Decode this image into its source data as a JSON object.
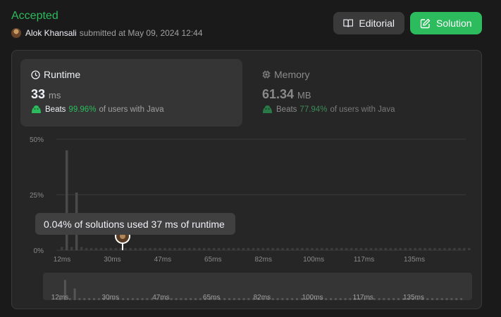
{
  "header": {
    "status": "Accepted",
    "author": "Alok Khansali",
    "submitted": "submitted at May 09, 2024 12:44",
    "editorial_label": "Editorial",
    "solution_label": "Solution"
  },
  "runtime": {
    "label": "Runtime",
    "value": "33",
    "unit": "ms",
    "beats_label": "Beats",
    "beats_pct": "99.96%",
    "beats_suffix": "of users with Java"
  },
  "memory": {
    "label": "Memory",
    "value": "61.34",
    "unit": "MB",
    "beats_label": "Beats",
    "beats_pct": "77.94%",
    "beats_suffix": "of users with Java"
  },
  "tooltip": "0.04% of solutions used 37 ms of runtime",
  "colors": {
    "accent": "#2cbb5d",
    "background": "#1a1a1a",
    "card": "#262626"
  },
  "chart_data": {
    "type": "bar",
    "ylabel": "",
    "ylim": [
      0,
      50
    ],
    "y_ticks": [
      "50%",
      "25%",
      "0%"
    ],
    "x_ticks": [
      "12ms",
      "30ms",
      "47ms",
      "65ms",
      "82ms",
      "100ms",
      "117ms",
      "135ms"
    ],
    "values": [
      1.5,
      45,
      1.5,
      26,
      1.5,
      1,
      1,
      1,
      1,
      1,
      1,
      1,
      1,
      1,
      1,
      1,
      1,
      1,
      1,
      1,
      1,
      1,
      1,
      1,
      1,
      1,
      1,
      1,
      1,
      1,
      1,
      1,
      1,
      1,
      1,
      1,
      1,
      1,
      1,
      1,
      1,
      1,
      1,
      1,
      1,
      1,
      1,
      1,
      1,
      1,
      1,
      1,
      1,
      1,
      1,
      1,
      1,
      1,
      1,
      1,
      1,
      1,
      1,
      1,
      1,
      1,
      1,
      1,
      1,
      1,
      1,
      1,
      1,
      1,
      1,
      1,
      1,
      1,
      1,
      1,
      1,
      1,
      1,
      1
    ]
  }
}
